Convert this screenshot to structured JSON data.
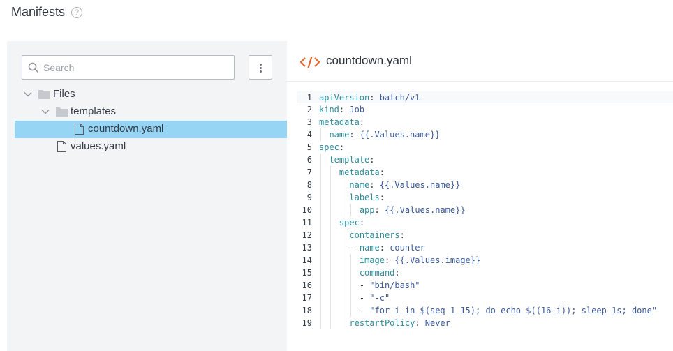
{
  "header": {
    "title": "Manifests",
    "help": "?"
  },
  "sidebar": {
    "search_placeholder": "Search",
    "tree": {
      "root": "Files",
      "folder": "templates",
      "file_selected": "countdown.yaml",
      "file_other": "values.yaml"
    }
  },
  "editor": {
    "title": "countdown.yaml",
    "lines": [
      {
        "n": "1",
        "indent": 0,
        "key": "apiVersion",
        "sep": ": ",
        "val": "batch/v1"
      },
      {
        "n": "2",
        "indent": 0,
        "key": "kind",
        "sep": ": ",
        "val": "Job"
      },
      {
        "n": "3",
        "indent": 0,
        "key": "metadata",
        "sep": ":",
        "val": ""
      },
      {
        "n": "4",
        "indent": 1,
        "key": "name",
        "sep": ": ",
        "val": "{{.Values.name}}"
      },
      {
        "n": "5",
        "indent": 0,
        "key": "spec",
        "sep": ":",
        "val": ""
      },
      {
        "n": "6",
        "indent": 1,
        "key": "template",
        "sep": ":",
        "val": ""
      },
      {
        "n": "7",
        "indent": 2,
        "key": "metadata",
        "sep": ":",
        "val": ""
      },
      {
        "n": "8",
        "indent": 3,
        "key": "name",
        "sep": ": ",
        "val": "{{.Values.name}}"
      },
      {
        "n": "9",
        "indent": 3,
        "key": "labels",
        "sep": ":",
        "val": ""
      },
      {
        "n": "10",
        "indent": 4,
        "key": "app",
        "sep": ": ",
        "val": "{{.Values.name}}"
      },
      {
        "n": "11",
        "indent": 2,
        "key": "spec",
        "sep": ":",
        "val": ""
      },
      {
        "n": "12",
        "indent": 3,
        "key": "containers",
        "sep": ":",
        "val": ""
      },
      {
        "n": "13",
        "indent": 3,
        "dash": true,
        "key": "name",
        "sep": ": ",
        "val": "counter"
      },
      {
        "n": "14",
        "indent": 4,
        "key": "image",
        "sep": ": ",
        "val": "{{.Values.image}}"
      },
      {
        "n": "15",
        "indent": 4,
        "key": "command",
        "sep": ":",
        "val": ""
      },
      {
        "n": "16",
        "indent": 4,
        "dash": true,
        "key": "",
        "sep": "",
        "val": "\"bin/bash\""
      },
      {
        "n": "17",
        "indent": 4,
        "dash": true,
        "key": "",
        "sep": "",
        "val": "\"-c\""
      },
      {
        "n": "18",
        "indent": 4,
        "dash": true,
        "key": "",
        "sep": "",
        "val": "\"for i in $(seq 1 15); do echo $((16-i)); sleep 1s; done\""
      },
      {
        "n": "19",
        "indent": 3,
        "key": "restartPolicy",
        "sep": ": ",
        "val": "Never"
      }
    ]
  },
  "colors": {
    "selected_row": "#97d5f5",
    "code_icon": "#e8632a",
    "yaml_key": "#2c8c9a",
    "yaml_value": "#3a5a9a"
  }
}
